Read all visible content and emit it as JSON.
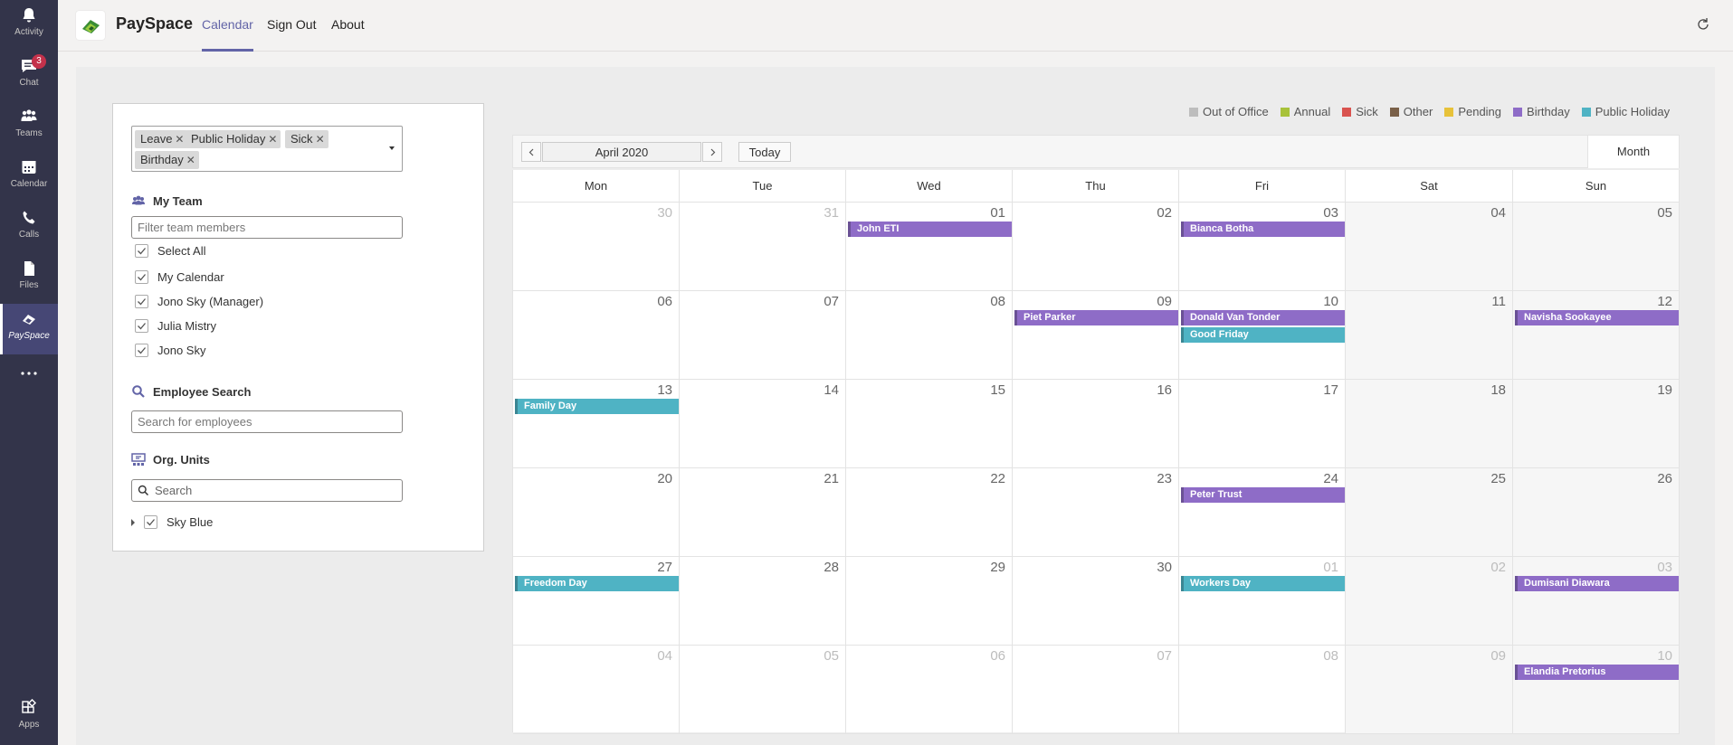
{
  "rail": {
    "items": [
      {
        "label": "Activity",
        "icon": "bell-icon"
      },
      {
        "label": "Chat",
        "icon": "chat-icon",
        "badge": "3"
      },
      {
        "label": "Teams",
        "icon": "teams-icon"
      },
      {
        "label": "Calendar",
        "icon": "calendar-icon"
      },
      {
        "label": "Calls",
        "icon": "phone-icon"
      },
      {
        "label": "Files",
        "icon": "file-icon"
      },
      {
        "label": "PaySpace",
        "icon": "payspace-icon"
      },
      {
        "label": "",
        "icon": "more-icon"
      },
      {
        "label": "Apps",
        "icon": "apps-icon"
      }
    ]
  },
  "header": {
    "app_name": "PaySpace",
    "tabs": [
      "Calendar",
      "Sign Out",
      "About"
    ],
    "active_tab": "Calendar"
  },
  "filters": {
    "tags": [
      "Leave",
      "Public Holiday",
      "Sick",
      "Birthday"
    ],
    "my_team": {
      "title": "My Team",
      "filter_placeholder": "Filter team members",
      "members": [
        "Select All",
        "My Calendar",
        "Jono Sky (Manager)",
        "Julia Mistry",
        "Jono Sky"
      ]
    },
    "employee_search": {
      "title": "Employee Search",
      "placeholder": "Search for employees"
    },
    "org_units": {
      "title": "Org. Units",
      "placeholder": "Search",
      "units": [
        "Sky Blue"
      ]
    }
  },
  "legend": [
    {
      "label": "Out of Office",
      "color": "#bdbdbd"
    },
    {
      "label": "Annual",
      "color": "#a8c23a"
    },
    {
      "label": "Sick",
      "color": "#d9534f"
    },
    {
      "label": "Other",
      "color": "#7a6048"
    },
    {
      "label": "Pending",
      "color": "#e7c23a"
    },
    {
      "label": "Birthday",
      "color": "#8e6cc7"
    },
    {
      "label": "Public Holiday",
      "color": "#4fb3c4"
    }
  ],
  "calendar": {
    "period": "April 2020",
    "today_label": "Today",
    "view_label": "Month",
    "weekdays": [
      "Mon",
      "Tue",
      "Wed",
      "Thu",
      "Fri",
      "Sat",
      "Sun"
    ],
    "weeks": [
      [
        {
          "d": "30",
          "o": true
        },
        {
          "d": "31",
          "o": true
        },
        {
          "d": "01"
        },
        {
          "d": "02"
        },
        {
          "d": "03"
        },
        {
          "d": "04"
        },
        {
          "d": "05"
        }
      ],
      [
        {
          "d": "06"
        },
        {
          "d": "07"
        },
        {
          "d": "08"
        },
        {
          "d": "09"
        },
        {
          "d": "10"
        },
        {
          "d": "11"
        },
        {
          "d": "12"
        }
      ],
      [
        {
          "d": "13"
        },
        {
          "d": "14"
        },
        {
          "d": "15"
        },
        {
          "d": "16"
        },
        {
          "d": "17"
        },
        {
          "d": "18"
        },
        {
          "d": "19"
        }
      ],
      [
        {
          "d": "20"
        },
        {
          "d": "21"
        },
        {
          "d": "22"
        },
        {
          "d": "23"
        },
        {
          "d": "24"
        },
        {
          "d": "25"
        },
        {
          "d": "26"
        }
      ],
      [
        {
          "d": "27"
        },
        {
          "d": "28"
        },
        {
          "d": "29"
        },
        {
          "d": "30"
        },
        {
          "d": "01",
          "o": true
        },
        {
          "d": "02",
          "o": true
        },
        {
          "d": "03",
          "o": true
        }
      ],
      [
        {
          "d": "04",
          "o": true
        },
        {
          "d": "05",
          "o": true
        },
        {
          "d": "06",
          "o": true
        },
        {
          "d": "07",
          "o": true
        },
        {
          "d": "08",
          "o": true
        },
        {
          "d": "09",
          "o": true
        },
        {
          "d": "10",
          "o": true
        }
      ]
    ],
    "events": [
      {
        "week": 0,
        "day": 2,
        "slot": 0,
        "label": "John ETI",
        "type": "Birthday"
      },
      {
        "week": 0,
        "day": 4,
        "slot": 0,
        "label": "Bianca Botha",
        "type": "Birthday"
      },
      {
        "week": 1,
        "day": 3,
        "slot": 0,
        "label": "Piet Parker",
        "type": "Birthday"
      },
      {
        "week": 1,
        "day": 4,
        "slot": 0,
        "label": "Donald Van Tonder",
        "type": "Birthday"
      },
      {
        "week": 1,
        "day": 4,
        "slot": 1,
        "label": "Good Friday",
        "type": "Public Holiday"
      },
      {
        "week": 1,
        "day": 6,
        "slot": 0,
        "label": "Navisha Sookayee",
        "type": "Birthday"
      },
      {
        "week": 2,
        "day": 0,
        "slot": 0,
        "label": "Family Day",
        "type": "Public Holiday"
      },
      {
        "week": 3,
        "day": 4,
        "slot": 0,
        "label": "Peter Trust",
        "type": "Birthday"
      },
      {
        "week": 4,
        "day": 0,
        "slot": 0,
        "label": "Freedom Day",
        "type": "Public Holiday"
      },
      {
        "week": 4,
        "day": 4,
        "slot": 0,
        "label": "Workers Day",
        "type": "Public Holiday"
      },
      {
        "week": 4,
        "day": 6,
        "slot": 0,
        "label": "Dumisani Diawara",
        "type": "Birthday"
      },
      {
        "week": 5,
        "day": 6,
        "slot": 0,
        "label": "Elandia Pretorius",
        "type": "Birthday"
      }
    ]
  }
}
